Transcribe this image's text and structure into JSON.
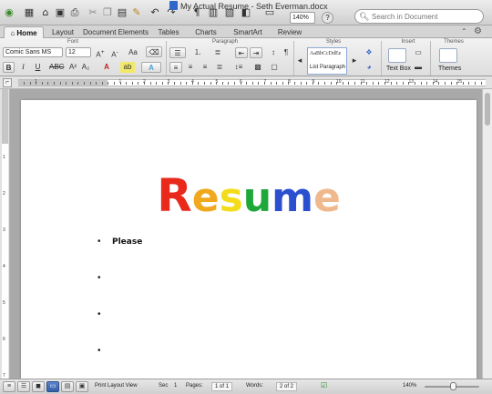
{
  "window": {
    "title": "My Actual Resume - Seth Everman.docx",
    "zoom": "140%",
    "help": "?",
    "search_placeholder": "Search in Document"
  },
  "tabs": [
    {
      "label": "Home",
      "active": true
    },
    {
      "label": "Layout"
    },
    {
      "label": "Document Elements"
    },
    {
      "label": "Tables"
    },
    {
      "label": "Charts"
    },
    {
      "label": "SmartArt"
    },
    {
      "label": "Review"
    }
  ],
  "ribbon": {
    "groups": {
      "font": "Font",
      "paragraph": "Paragraph",
      "styles": "Styles",
      "insert": "Insert",
      "themes": "Themes"
    },
    "font_name": "Comic Sans MS",
    "font_size": "12",
    "style_sample": "AaBbCcDdEe",
    "style_name": "List Paragraph",
    "text_box_label": "Text Box",
    "themes_label": "Themes"
  },
  "ruler": {
    "numbers": [
      "1",
      "1",
      "2",
      "3",
      "4",
      "5",
      "6",
      "7",
      "8",
      "9",
      "10",
      "11",
      "12",
      "13",
      "14",
      "15",
      "16",
      "17",
      "18"
    ],
    "vertical_numbers": [
      "1",
      "2",
      "3",
      "4",
      "5",
      "6",
      "7"
    ]
  },
  "document": {
    "heading_letters": [
      {
        "char": "R",
        "color": "#e8291c"
      },
      {
        "char": "e",
        "color": "#f0a81e"
      },
      {
        "char": "s",
        "color": "#f3dd1a"
      },
      {
        "char": "u",
        "color": "#1fa83a"
      },
      {
        "char": "m",
        "color": "#2a4fcf"
      },
      {
        "char": "e",
        "color": "#f0b98d"
      }
    ],
    "bullets": [
      "Please",
      "",
      "",
      "",
      ""
    ]
  },
  "status": {
    "view": "Print Layout View",
    "sec_label": "Sec",
    "sec_value": "1",
    "pages_label": "Pages:",
    "pages_value": "1 of 1",
    "words_label": "Words:",
    "words_value": "2 of 2",
    "zoom": "140%"
  },
  "colors": {
    "active_view": "#335ea8",
    "page": "#ffffff",
    "canvas": "#a9a9a9"
  }
}
